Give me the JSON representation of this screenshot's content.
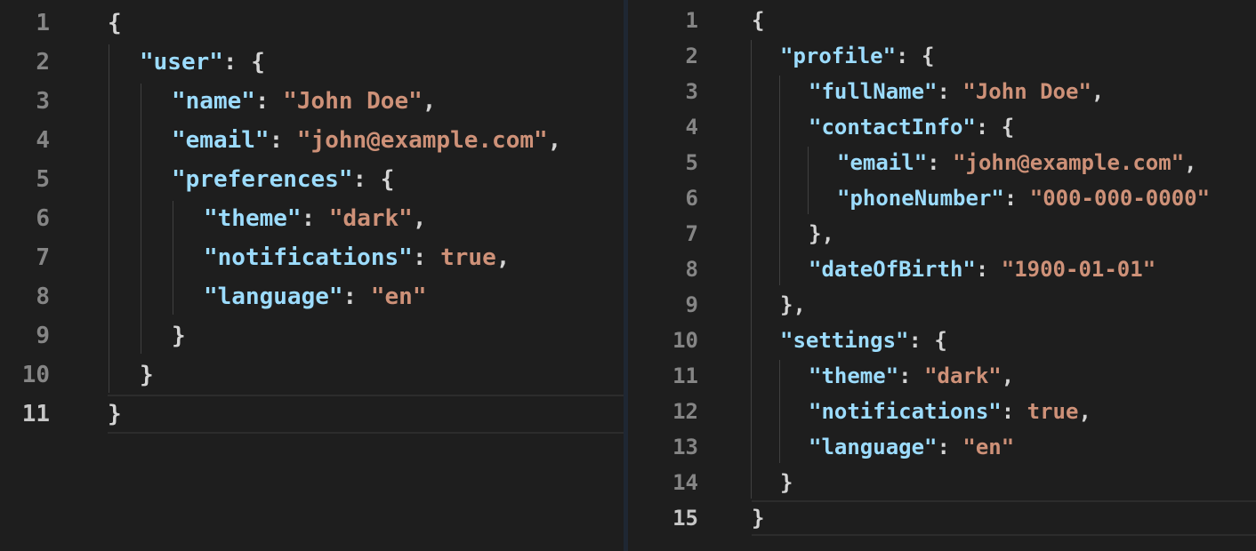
{
  "left_editor": {
    "active_line": 11,
    "lines": [
      {
        "n": "1",
        "indent": 0,
        "parts": [
          {
            "t": "p",
            "v": "{"
          }
        ]
      },
      {
        "n": "2",
        "indent": 1,
        "parts": [
          {
            "t": "k",
            "v": "\"user\""
          },
          {
            "t": "p",
            "v": ": {"
          }
        ]
      },
      {
        "n": "3",
        "indent": 2,
        "parts": [
          {
            "t": "k",
            "v": "\"name\""
          },
          {
            "t": "p",
            "v": ": "
          },
          {
            "t": "s",
            "v": "\"John Doe\""
          },
          {
            "t": "p",
            "v": ","
          }
        ]
      },
      {
        "n": "4",
        "indent": 2,
        "parts": [
          {
            "t": "k",
            "v": "\"email\""
          },
          {
            "t": "p",
            "v": ": "
          },
          {
            "t": "s",
            "v": "\"john@example.com\""
          },
          {
            "t": "p",
            "v": ","
          }
        ]
      },
      {
        "n": "5",
        "indent": 2,
        "parts": [
          {
            "t": "k",
            "v": "\"preferences\""
          },
          {
            "t": "p",
            "v": ": {"
          }
        ]
      },
      {
        "n": "6",
        "indent": 3,
        "parts": [
          {
            "t": "k",
            "v": "\"theme\""
          },
          {
            "t": "p",
            "v": ": "
          },
          {
            "t": "s",
            "v": "\"dark\""
          },
          {
            "t": "p",
            "v": ","
          }
        ]
      },
      {
        "n": "7",
        "indent": 3,
        "parts": [
          {
            "t": "k",
            "v": "\"notifications\""
          },
          {
            "t": "p",
            "v": ": "
          },
          {
            "t": "s",
            "v": "true"
          },
          {
            "t": "p",
            "v": ","
          }
        ]
      },
      {
        "n": "8",
        "indent": 3,
        "parts": [
          {
            "t": "k",
            "v": "\"language\""
          },
          {
            "t": "p",
            "v": ": "
          },
          {
            "t": "s",
            "v": "\"en\""
          }
        ]
      },
      {
        "n": "9",
        "indent": 2,
        "parts": [
          {
            "t": "p",
            "v": "}"
          }
        ]
      },
      {
        "n": "10",
        "indent": 1,
        "parts": [
          {
            "t": "p",
            "v": "}"
          }
        ]
      },
      {
        "n": "11",
        "indent": 0,
        "parts": [
          {
            "t": "p",
            "v": "}"
          }
        ]
      }
    ]
  },
  "right_editor": {
    "active_line": 15,
    "lines": [
      {
        "n": "1",
        "indent": 0,
        "parts": [
          {
            "t": "p",
            "v": "{"
          }
        ]
      },
      {
        "n": "2",
        "indent": 1,
        "parts": [
          {
            "t": "k",
            "v": "\"profile\""
          },
          {
            "t": "p",
            "v": ": {"
          }
        ]
      },
      {
        "n": "3",
        "indent": 2,
        "parts": [
          {
            "t": "k",
            "v": "\"fullName\""
          },
          {
            "t": "p",
            "v": ": "
          },
          {
            "t": "s",
            "v": "\"John Doe\""
          },
          {
            "t": "p",
            "v": ","
          }
        ]
      },
      {
        "n": "4",
        "indent": 2,
        "parts": [
          {
            "t": "k",
            "v": "\"contactInfo\""
          },
          {
            "t": "p",
            "v": ": {"
          }
        ]
      },
      {
        "n": "5",
        "indent": 3,
        "parts": [
          {
            "t": "k",
            "v": "\"email\""
          },
          {
            "t": "p",
            "v": ": "
          },
          {
            "t": "s",
            "v": "\"john@example.com\""
          },
          {
            "t": "p",
            "v": ","
          }
        ]
      },
      {
        "n": "6",
        "indent": 3,
        "parts": [
          {
            "t": "k",
            "v": "\"phoneNumber\""
          },
          {
            "t": "p",
            "v": ": "
          },
          {
            "t": "s",
            "v": "\"000-000-0000\""
          }
        ]
      },
      {
        "n": "7",
        "indent": 2,
        "parts": [
          {
            "t": "p",
            "v": "},"
          }
        ]
      },
      {
        "n": "8",
        "indent": 2,
        "parts": [
          {
            "t": "k",
            "v": "\"dateOfBirth\""
          },
          {
            "t": "p",
            "v": ": "
          },
          {
            "t": "s",
            "v": "\"1900-01-01\""
          }
        ]
      },
      {
        "n": "9",
        "indent": 1,
        "parts": [
          {
            "t": "p",
            "v": "},"
          }
        ]
      },
      {
        "n": "10",
        "indent": 1,
        "parts": [
          {
            "t": "k",
            "v": "\"settings\""
          },
          {
            "t": "p",
            "v": ": {"
          }
        ]
      },
      {
        "n": "11",
        "indent": 2,
        "parts": [
          {
            "t": "k",
            "v": "\"theme\""
          },
          {
            "t": "p",
            "v": ": "
          },
          {
            "t": "s",
            "v": "\"dark\""
          },
          {
            "t": "p",
            "v": ","
          }
        ]
      },
      {
        "n": "12",
        "indent": 2,
        "parts": [
          {
            "t": "k",
            "v": "\"notifications\""
          },
          {
            "t": "p",
            "v": ": "
          },
          {
            "t": "s",
            "v": "true"
          },
          {
            "t": "p",
            "v": ","
          }
        ]
      },
      {
        "n": "13",
        "indent": 2,
        "parts": [
          {
            "t": "k",
            "v": "\"language\""
          },
          {
            "t": "p",
            "v": ": "
          },
          {
            "t": "s",
            "v": "\"en\""
          }
        ]
      },
      {
        "n": "14",
        "indent": 1,
        "parts": [
          {
            "t": "p",
            "v": "}"
          }
        ]
      },
      {
        "n": "15",
        "indent": 0,
        "parts": [
          {
            "t": "p",
            "v": "}"
          }
        ]
      }
    ]
  },
  "colors": {
    "background": "#1e1e1e",
    "json_key": "#9cdcfe",
    "json_string": "#ce9178",
    "punctuation": "#d4d4d4",
    "line_number": "#858585",
    "active_line_number": "#c6c6c6"
  }
}
